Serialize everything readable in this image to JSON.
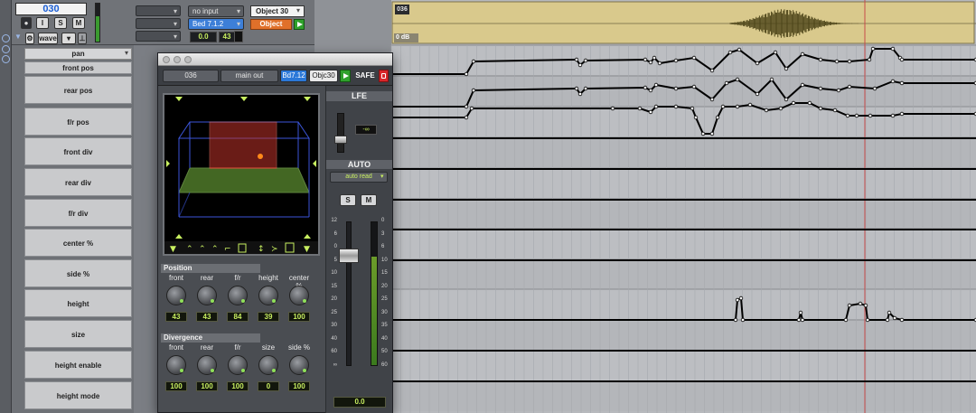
{
  "track": {
    "name": "030",
    "solo_label": "S",
    "mute_label": "M",
    "view_label": "wave",
    "input": "no input",
    "output": "Bed 7.1.2",
    "gain": "0.0",
    "pan_value": "43",
    "object_label": "Object 30",
    "object_mode": "Object",
    "auto_param": "pan"
  },
  "lanes": [
    {
      "label": "front pos"
    },
    {
      "label": "rear pos"
    },
    {
      "label": "f/r pos"
    },
    {
      "label": "front div"
    },
    {
      "label": "rear div"
    },
    {
      "label": "f/r div"
    },
    {
      "label": "center %"
    },
    {
      "label": "side %"
    },
    {
      "label": "height"
    },
    {
      "label": "size"
    },
    {
      "label": "height enable"
    },
    {
      "label": "height mode"
    }
  ],
  "clip": {
    "name": "036",
    "gain": "0 dB"
  },
  "plugin": {
    "track": "036",
    "output": "main out",
    "bed": "Bd7.12",
    "object": "Objc30",
    "safe": "SAFE",
    "position_title": "Position",
    "position": [
      {
        "label": "front",
        "value": "43"
      },
      {
        "label": "rear",
        "value": "43"
      },
      {
        "label": "f/r",
        "value": "84"
      },
      {
        "label": "height",
        "value": "39"
      },
      {
        "label": "center %",
        "value": "100"
      }
    ],
    "divergence_title": "Divergence",
    "divergence": [
      {
        "label": "front",
        "value": "100"
      },
      {
        "label": "rear",
        "value": "100"
      },
      {
        "label": "f/r",
        "value": "100"
      },
      {
        "label": "size",
        "value": "0"
      },
      {
        "label": "side %",
        "value": "100"
      }
    ],
    "lfe_title": "LFE",
    "lfe_value": "-∞",
    "auto_title": "AUTO",
    "auto_mode": "auto read",
    "solo": "S",
    "mute": "M",
    "scale_left": [
      "12",
      "6",
      "0",
      "5",
      "10",
      "15",
      "20",
      "25",
      "30",
      "40",
      "60",
      "∞"
    ],
    "scale_right": [
      "0",
      "3",
      "6",
      "10",
      "15",
      "20",
      "25",
      "30",
      "35",
      "40",
      "50",
      "60"
    ],
    "output_level": "0.0"
  }
}
